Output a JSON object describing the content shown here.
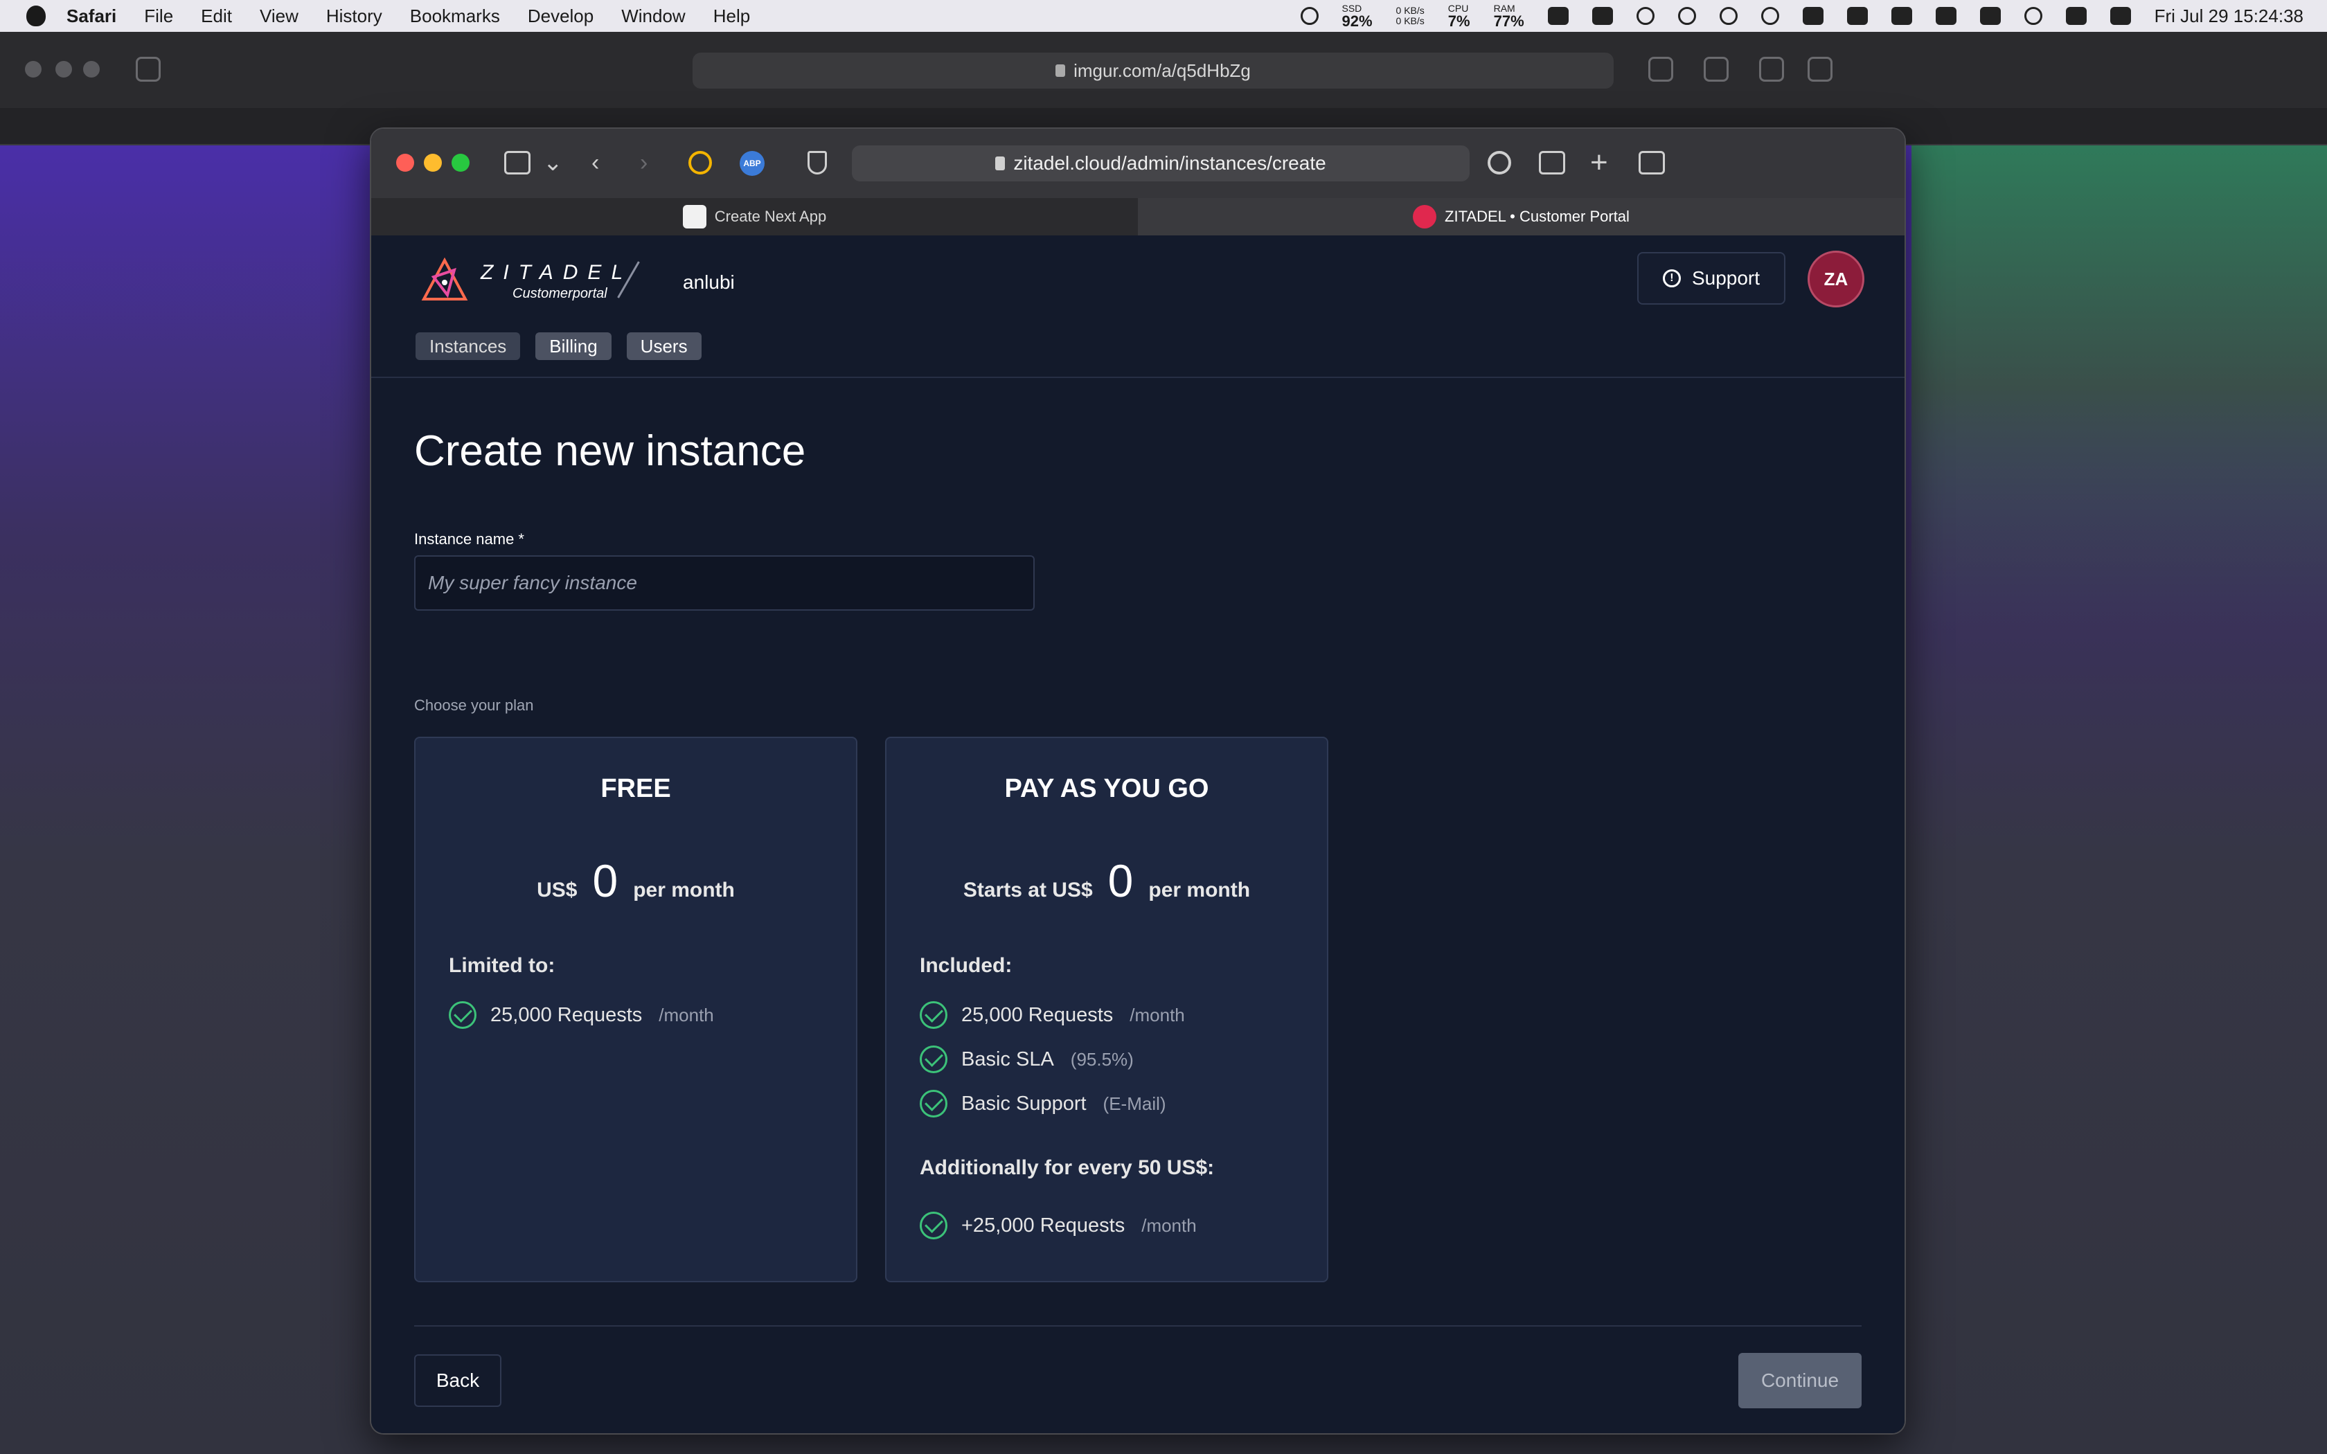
{
  "menubar": {
    "app": "Safari",
    "items": [
      "File",
      "Edit",
      "View",
      "History",
      "Bookmarks",
      "Develop",
      "Window",
      "Help"
    ],
    "ssd_label": "SSD",
    "ssd_value": "92%",
    "net_up": "0 KB/s",
    "net_down": "0 KB/s",
    "cpu_label": "CPU",
    "cpu_value": "7%",
    "ram_label": "RAM",
    "ram_value": "77%",
    "datetime": "Fri Jul 29  15:24:38"
  },
  "bg_window": {
    "url": "imgur.com/a/q5dHbZg"
  },
  "browser": {
    "url": "zitadel.cloud/admin/instances/create",
    "tabs": [
      {
        "label": "Create Next App",
        "active": false
      },
      {
        "label": "ZITADEL • Customer Portal",
        "active": true
      }
    ]
  },
  "header": {
    "brand": "ZITADEL",
    "brand_sub": "Customerportal",
    "org": "anlubi",
    "support_label": "Support",
    "avatar_initials": "ZA",
    "nav": [
      "Instances",
      "Billing",
      "Users"
    ]
  },
  "form": {
    "title": "Create new instance",
    "name_label": "Instance name *",
    "name_placeholder": "My super fancy instance",
    "plan_label": "Choose your plan"
  },
  "plans": {
    "free": {
      "title": "FREE",
      "currency": "US$",
      "amount": "0",
      "period": "per month",
      "section": "Limited to:",
      "features": [
        {
          "text": "25,000 Requests",
          "note": "/month"
        }
      ]
    },
    "payg": {
      "title": "PAY AS YOU GO",
      "currency": "Starts at US$",
      "amount": "0",
      "period": "per month",
      "section": "Included:",
      "features": [
        {
          "text": "25,000 Requests",
          "note": "/month"
        },
        {
          "text": "Basic SLA",
          "note": "(95.5%)"
        },
        {
          "text": "Basic Support",
          "note": "(E-Mail)"
        }
      ],
      "section2": "Additionally for every 50 US$:",
      "extra": [
        {
          "text": "+25,000 Requests",
          "note": "/month"
        }
      ]
    }
  },
  "actions": {
    "back": "Back",
    "continue": "Continue"
  },
  "colors": {
    "page_bg": "#131a2b",
    "card_bg": "#1d2740",
    "accent_check": "#3cc279",
    "avatar": "#8c1c3a"
  }
}
